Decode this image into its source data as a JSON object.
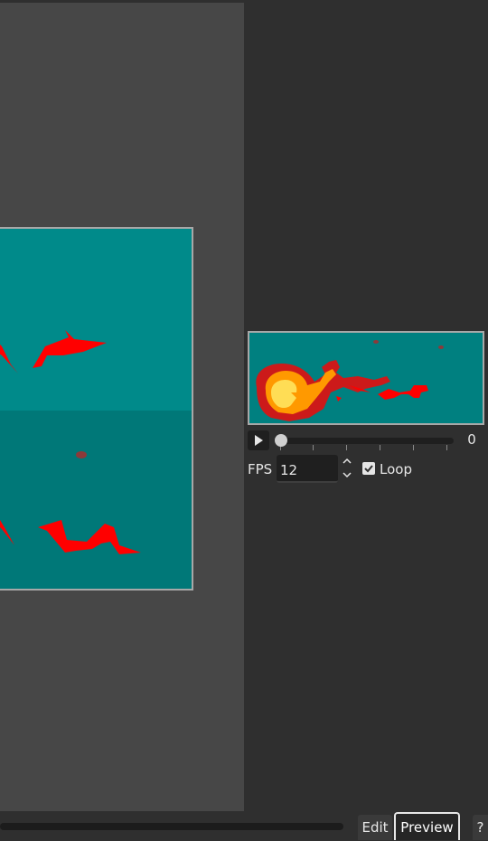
{
  "player": {
    "current_frame": "0",
    "frame_ticks": 6,
    "fps_label": "FPS",
    "fps_value": "12",
    "loop_label": "Loop",
    "loop_checked": true
  },
  "tabs": {
    "edit": "Edit",
    "preview": "Preview",
    "help": "?"
  },
  "colors": {
    "canvas_bg": "#474747",
    "panel_bg": "#2f2f2f",
    "sprite_bg": "#008080",
    "flame_red": "#ff0000",
    "flame_orange": "#ff9900",
    "flame_yellow": "#ffdd55"
  },
  "icons": {
    "play": "play-icon",
    "spin": "spinner-arrows-icon",
    "check": "checkmark-icon"
  }
}
